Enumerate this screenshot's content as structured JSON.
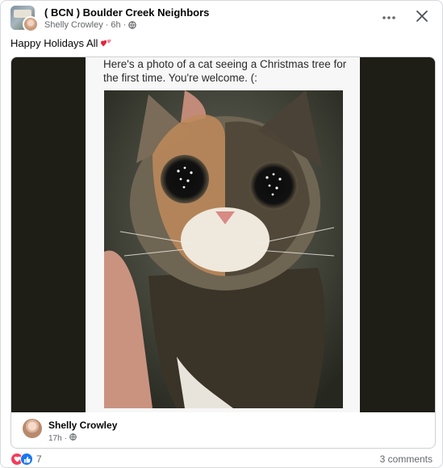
{
  "post": {
    "group_name": "( BCN ) Boulder Creek Neighbors",
    "author": "Shelly Crowley",
    "time": "6h",
    "separator": "·",
    "privacy_icon": "globe-icon",
    "text": "Happy Holidays All",
    "emoji_icon": "two-hearts-icon"
  },
  "actions": {
    "more_icon": "more-horizontal-icon",
    "close_icon": "close-icon"
  },
  "shared": {
    "caption": "Here's a photo of a cat seeing a Christmas tree for the first time. You're welcome. (:",
    "author": "Shelly Crowley",
    "time": "17h",
    "separator": "·"
  },
  "footer": {
    "reaction_count": "7",
    "comments": "3 comments",
    "reaction_icons": [
      "love-icon",
      "like-icon"
    ]
  },
  "colors": {
    "primary_text": "#050505",
    "secondary_text": "#65676b",
    "like_blue": "#1877f2",
    "love_red": "#f33e58"
  }
}
